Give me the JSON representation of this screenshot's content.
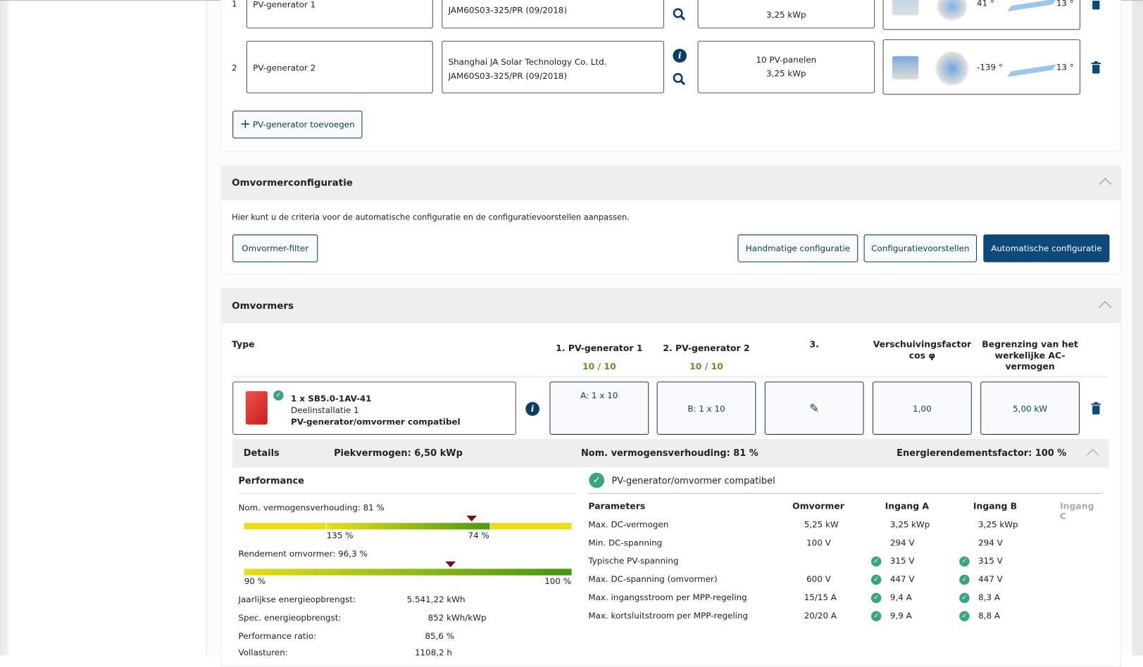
{
  "pv_generators": [
    {
      "index": "1",
      "name": "PV-generator 1",
      "module_line2": "JAM60S03-325/PR (09/2018)",
      "power": "3,25 kWp",
      "azimuth": "41 °",
      "tilt": "13 °"
    },
    {
      "index": "2",
      "name": "PV-generator 2",
      "module_line1": "Shanghai JA Solar Technology Co. Ltd.",
      "module_line2": "JAM60S03-325/PR (09/2018)",
      "panels": "10 PV-panelen",
      "power": "3,25 kWp",
      "azimuth": "-139 °",
      "tilt": "13 °"
    }
  ],
  "add_generator_label": "PV-generator toevoegen",
  "config": {
    "title": "Omvormerconfiguratie",
    "description": "Hier kunt u de criteria voor de automatische configuratie en de configuratievoorstellen aanpassen.",
    "filter_label": "Omvormer-filter",
    "manual_label": "Handmatige configuratie",
    "proposals_label": "Configuratievoorstellen",
    "auto_label": "Automatische configuratie"
  },
  "inverters": {
    "title": "Omvormers",
    "headers": {
      "type": "Type",
      "gen1": "1. PV-generator 1",
      "gen1_count": "10 / 10",
      "gen2": "2. PV-generator 2",
      "gen2_count": "10 / 10",
      "gen3": "3.",
      "cos": "Verschuivingsfactor cos φ",
      "ac": "Begrenzing van het werkelijke AC-vermogen"
    },
    "row": {
      "model": "1 x SB5.0-1AV-41",
      "sub": "Deelinstallatie 1",
      "status": "PV-generator/omvormer compatibel",
      "gen1": "A: 1 x 10",
      "gen2": "B: 1 x 10",
      "cos": "1,00",
      "ac": "5,00 kW"
    },
    "details": {
      "label": "Details",
      "peak": "Piekvermogen: 6,50 kWp",
      "ratio": "Nom. vermogensverhouding: 81 %",
      "energy": "Energierendementsfactor: 100 %"
    }
  },
  "performance": {
    "title": "Performance",
    "ratio_label": "Nom. vermogensverhouding: 81 %",
    "ratio_ticks": [
      "135 %",
      "74 %"
    ],
    "ratio_value": 81,
    "eff_label": "Rendement omvormer: 96,3 %",
    "eff_ticks": [
      "90 %",
      "100 %"
    ],
    "eff_value": 96.3,
    "stats": [
      {
        "label": "Jaarlijkse energieopbrengst:",
        "value": "5.541,22 kWh"
      },
      {
        "label": "Spec. energieopbrengst:",
        "value": "852 kWh/kWp"
      },
      {
        "label": "Performance ratio:",
        "value": "85,6 %"
      },
      {
        "label": "Vollasturen:",
        "value": "1108,2 h"
      }
    ]
  },
  "compat": {
    "title": "PV-generator/omvormer compatibel",
    "headers": [
      "Parameters",
      "Omvormer",
      "Ingang A",
      "Ingang B",
      "Ingang C"
    ],
    "rows": [
      {
        "p": "Max. DC-vermogen",
        "o": "5,25 kW",
        "a": "3,25 kWp",
        "b": "3,25 kWp",
        "check": false
      },
      {
        "p": "Min. DC-spanning",
        "o": "100 V",
        "a": "294 V",
        "b": "294 V",
        "check": false
      },
      {
        "p": "Typische PV-spanning",
        "o": "",
        "a": "315 V",
        "b": "315 V",
        "check": true
      },
      {
        "p": "Max. DC-spanning (omvormer)",
        "o": "600 V",
        "a": "447 V",
        "b": "447 V",
        "check": true
      },
      {
        "p": "Max. ingangsstroom per MPP-regeling",
        "o": "15/15 A",
        "a": "9,4 A",
        "b": "8,3 A",
        "check": true
      },
      {
        "p": "Max. kortsluitstroom per MPP-regeling",
        "o": "20/20 A",
        "a": "9,9 A",
        "b": "8,8 A",
        "check": true
      }
    ]
  },
  "colors": {
    "primary": "#0b4a7b",
    "green": "#5a9a2a",
    "check": "#3aa57f",
    "marker": "#7a0a1e"
  }
}
